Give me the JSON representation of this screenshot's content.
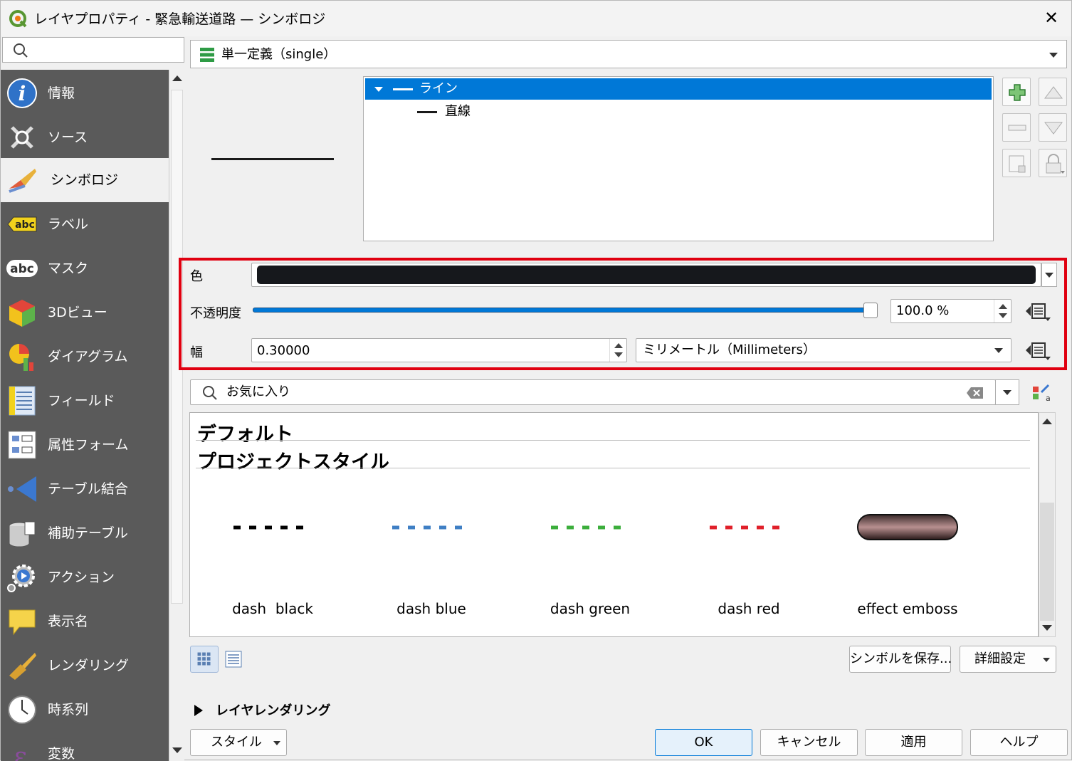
{
  "window": {
    "title": "レイヤプロパティ - 緊急輸送道路 — シンボロジ",
    "close_label": "✕"
  },
  "sidebar": {
    "search_placeholder": "",
    "items": [
      {
        "label": "情報",
        "icon": "info-icon"
      },
      {
        "label": "ソース",
        "icon": "source-tools-icon"
      },
      {
        "label": "シンボロジ",
        "icon": "symbology-brush-icon",
        "active": true
      },
      {
        "label": "ラベル",
        "icon": "labels-abc-icon"
      },
      {
        "label": "マスク",
        "icon": "mask-abc-icon"
      },
      {
        "label": "3Dビュー",
        "icon": "3d-cube-icon"
      },
      {
        "label": "ダイアグラム",
        "icon": "diagram-icon"
      },
      {
        "label": "フィールド",
        "icon": "fields-icon"
      },
      {
        "label": "属性フォーム",
        "icon": "attribute-form-icon"
      },
      {
        "label": "テーブル結合",
        "icon": "join-icon"
      },
      {
        "label": "補助テーブル",
        "icon": "auxiliary-storage-icon"
      },
      {
        "label": "アクション",
        "icon": "action-gear-icon"
      },
      {
        "label": "表示名",
        "icon": "display-bubble-icon"
      },
      {
        "label": "レンダリング",
        "icon": "rendering-brush-icon"
      },
      {
        "label": "時系列",
        "icon": "temporal-clock-icon"
      },
      {
        "label": "変数",
        "icon": "variables-epsilon-icon"
      }
    ]
  },
  "renderer": {
    "label": "単一定義（single）"
  },
  "symbol_tree": {
    "root": "ライン",
    "child": "直線"
  },
  "properties": {
    "color_label": "色",
    "color_value": "#16181c",
    "opacity_label": "不透明度",
    "opacity_value": "100.0 %",
    "opacity_fraction": 1.0,
    "width_label": "幅",
    "width_value": "0.30000",
    "unit_value": "ミリメートル（Millimeters）"
  },
  "library": {
    "search_value": "お気に入り",
    "groups": [
      "デフォルト",
      "プロジェクトスタイル"
    ],
    "symbols": [
      {
        "name": "dash  black",
        "color": "#000000"
      },
      {
        "name": "dash blue",
        "color": "#3f7fc4"
      },
      {
        "name": "dash green",
        "color": "#3cae3c"
      },
      {
        "name": "dash red",
        "color": "#e0202a"
      },
      {
        "name": "effect emboss",
        "color": "#8a6b6b"
      }
    ]
  },
  "buttons": {
    "save_symbol": "シンボルを保存...",
    "advanced": "詳細設定",
    "style": "スタイル",
    "ok": "OK",
    "cancel": "キャンセル",
    "apply": "適用",
    "help": "ヘルプ"
  },
  "section": {
    "layer_rendering": "レイヤレンダリング"
  },
  "colors": {
    "accent": "#0078d7",
    "highlight_box": "#e00010",
    "sidebar_bg": "#5a5a5a"
  }
}
